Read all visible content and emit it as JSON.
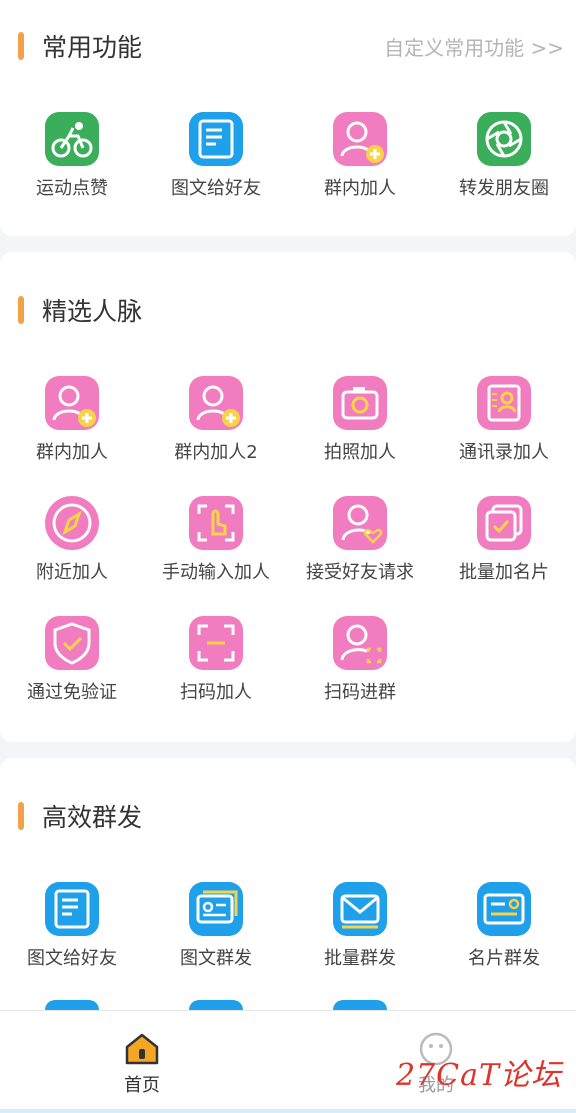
{
  "sections": {
    "common": {
      "title": "常用功能",
      "custom_link": "自定义常用功能 >>",
      "items": [
        "运动点赞",
        "图文给好友",
        "群内加人",
        "转发朋友圈"
      ]
    },
    "contacts": {
      "title": "精选人脉",
      "items": [
        "群内加人",
        "群内加人2",
        "拍照加人",
        "通讯录加人",
        "附近加人",
        "手动输入加人",
        "接受好友请求",
        "批量加名片",
        "通过免验证",
        "扫码加人",
        "扫码进群"
      ]
    },
    "broadcast": {
      "title": "高效群发",
      "items": [
        "图文给好友",
        "图文群发",
        "批量群发",
        "名片群发"
      ]
    }
  },
  "tabbar": {
    "home": "首页",
    "mine": "我的"
  },
  "watermark": "27CaT论坛",
  "colors": {
    "accent_bar": "#f4a24a",
    "pink_icon": "#f27cc0",
    "blue_icon": "#1ea0ea",
    "green_icon": "#3aae5b"
  }
}
